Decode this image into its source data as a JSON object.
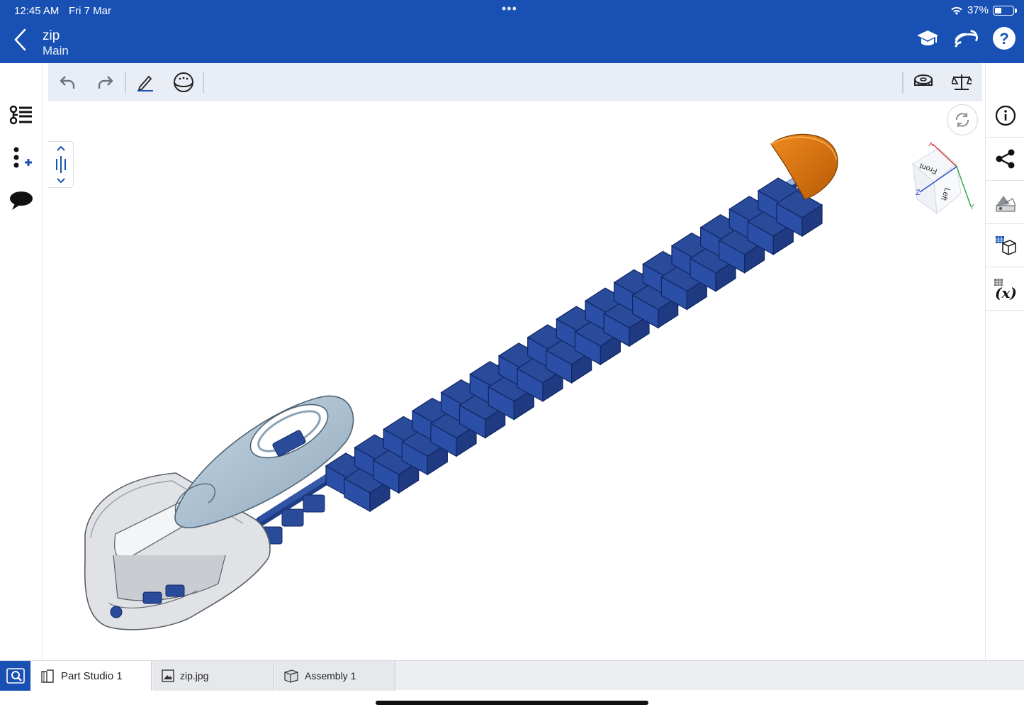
{
  "status": {
    "time": "12:45 AM",
    "date": "Fri 7 Mar",
    "battery": "37%",
    "battery_level": 0.37
  },
  "document": {
    "title": "zip",
    "workspace": "Main"
  },
  "top_actions": [
    "learning-center-icon",
    "share-screen-icon",
    "help-icon"
  ],
  "left_panel": [
    "feature-list-icon",
    "insert-feature-icon",
    "comments-icon"
  ],
  "toolbar": [
    "undo-icon",
    "redo-icon",
    "sketch-icon",
    "view-sphere-icon",
    "measure-icon",
    "mass-properties-icon"
  ],
  "right_panel": [
    "info-icon",
    "share-icon",
    "appearance-icon",
    "bom-icon",
    "variables-icon"
  ],
  "view_cube": {
    "faces": [
      "Front",
      "Left"
    ],
    "axes": [
      "X",
      "Y",
      "Z"
    ]
  },
  "tabs": [
    {
      "label": "Part Studio 1",
      "active": true
    },
    {
      "label": "zip.jpg",
      "active": false
    },
    {
      "label": "Assembly 1",
      "active": false
    }
  ],
  "colors": {
    "brand": "#1851b3",
    "teeth": "#2a4a9a",
    "stop": "#d9700f",
    "slider": "#d8dadd",
    "pull": "#a9bfd0"
  }
}
